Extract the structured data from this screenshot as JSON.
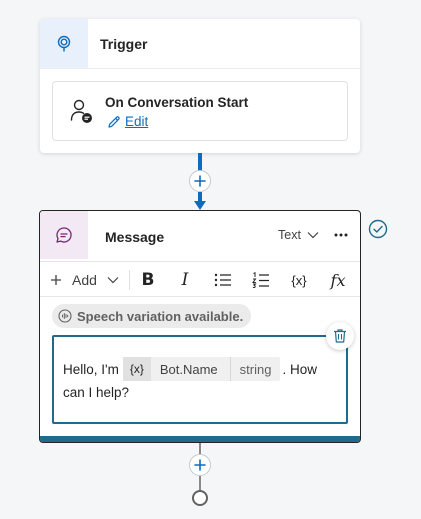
{
  "trigger": {
    "title": "Trigger",
    "event_name": "On Conversation Start",
    "edit_label": "Edit"
  },
  "message": {
    "title": "Message",
    "format_value": "Text",
    "toolbar": {
      "add_label": "Add",
      "variable_label": "{x}",
      "formula_label": "fx"
    },
    "speech_badge": "Speech variation available.",
    "text_before": "Hello, I'm",
    "text_after": ". How",
    "text_line2": "can I help?",
    "variable": {
      "icon_label": "{x}",
      "name": "Bot.Name",
      "type": "string"
    }
  },
  "colors": {
    "accent": "#0f6cbd",
    "teal": "#1e6b8c",
    "trigger_icon_bg": "#e8f1fb",
    "message_icon_bg": "#f3e9f4"
  },
  "icons": [
    "location-pin-icon",
    "person-chat-icon",
    "pencil-icon",
    "plus-icon",
    "chat-bubble-icon",
    "chevron-down-icon",
    "more-icon",
    "bold-icon",
    "italic-icon",
    "bullet-list-icon",
    "numbered-list-icon",
    "variable-icon",
    "formula-icon",
    "speech-icon",
    "delete-icon",
    "checkmark-circle-icon"
  ]
}
